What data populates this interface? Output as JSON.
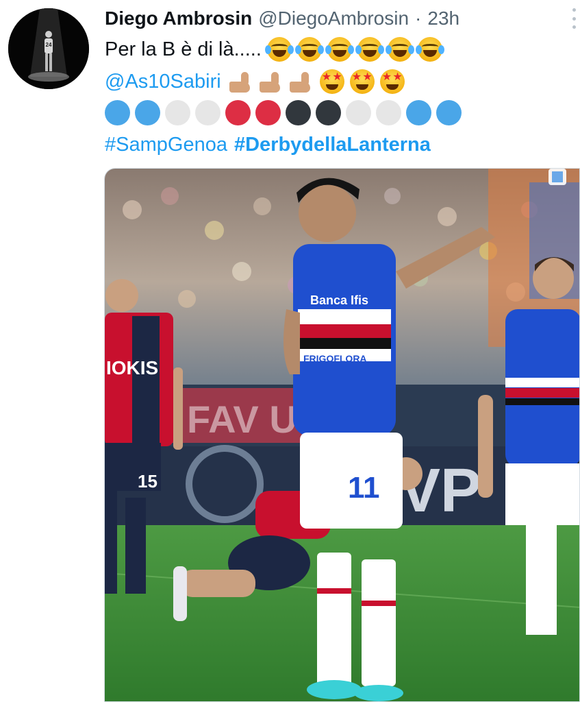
{
  "tweet": {
    "author_name": "Diego Ambrosin",
    "author_handle": "@DiegoAmbrosin",
    "separator": "·",
    "time": "23h",
    "line1_text": "Per la B è di là.....",
    "mention": "@As10Sabiri",
    "hashtag1": "#SampGenoa",
    "hashtag2": "#DerbydellaLanterna",
    "emojis_line1": [
      "face-with-tears-of-joy",
      "face-with-tears-of-joy",
      "face-with-tears-of-joy",
      "face-with-tears-of-joy",
      "face-with-tears-of-joy",
      "face-with-tears-of-joy"
    ],
    "emojis_line2_arms": [
      "flexed-biceps",
      "flexed-biceps",
      "flexed-biceps"
    ],
    "emojis_line2_stars": [
      "star-struck",
      "star-struck",
      "star-struck"
    ],
    "color_circles": [
      "#4aa6e8",
      "#4aa6e8",
      "#e6e6e6",
      "#e6e6e6",
      "#dd2e44",
      "#dd2e44",
      "#31373d",
      "#31373d",
      "#e6e6e6",
      "#e6e6e6",
      "#4aa6e8",
      "#4aa6e8"
    ]
  },
  "photo": {
    "jersey_number": "11",
    "shorts_number": "15",
    "sponsor_main": "Banca Ifis",
    "sponsor_small": "FRIGOFLORA",
    "opponent_sponsor": "IOKIS",
    "board_text": "FAV   URS",
    "board_text_2": "VP"
  },
  "colors": {
    "link": "#1d9bf0",
    "secondary_text": "#536471",
    "samp_blue": "#1f4fcf",
    "genoa_red": "#c8102e",
    "genoa_navy": "#1c2744",
    "pitch": "#3f8f3a"
  }
}
